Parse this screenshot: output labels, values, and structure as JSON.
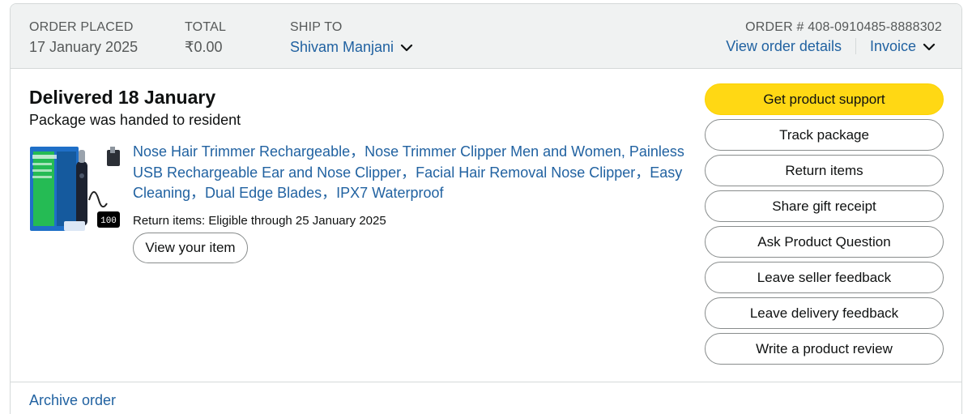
{
  "header": {
    "order_placed_label": "ORDER PLACED",
    "order_placed_value": "17 January 2025",
    "total_label": "TOTAL",
    "total_value": "₹0.00",
    "ship_to_label": "SHIP TO",
    "ship_to_value": "Shivam Manjani",
    "order_number": "ORDER # 408-0910485-8888302",
    "view_order_details": "View order details",
    "invoice": "Invoice"
  },
  "shipment": {
    "status_title": "Delivered 18 January",
    "status_subtitle": "Package was handed to resident",
    "product_title": "Nose Hair Trimmer Rechargeable，Nose Trimmer Clipper Men and Women, Painless USB Rechargeable Ear and Nose Clipper，Facial Hair Removal Nose Clipper，Easy Cleaning，Dual Edge Blades，IPX7 Waterproof",
    "return_note": "Return items: Eligible through 25 January 2025",
    "view_item_label": "View your item",
    "thumbnail_readout": "100"
  },
  "actions": [
    {
      "label": "Get product support",
      "style": "primary"
    },
    {
      "label": "Track package",
      "style": "secondary"
    },
    {
      "label": "Return items",
      "style": "secondary"
    },
    {
      "label": "Share gift receipt",
      "style": "secondary"
    },
    {
      "label": "Ask Product Question",
      "style": "secondary"
    },
    {
      "label": "Leave seller feedback",
      "style": "secondary"
    },
    {
      "label": "Leave delivery feedback",
      "style": "secondary"
    },
    {
      "label": "Write a product review",
      "style": "secondary"
    }
  ],
  "footer": {
    "archive_label": "Archive order"
  },
  "colors": {
    "header_bg": "#f0f2f2",
    "link": "#2162a1",
    "primary_button": "#ffd814",
    "border": "#d5d9d9"
  }
}
